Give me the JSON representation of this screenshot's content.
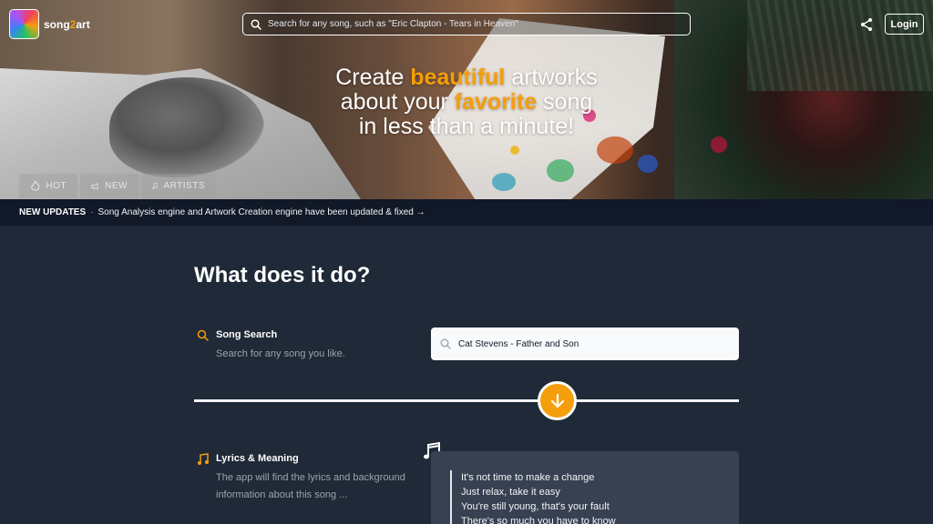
{
  "app": {
    "name_part1": "song",
    "name_part2": "2",
    "name_part3": "art"
  },
  "search": {
    "placeholder": "Search for any song, such as \"Eric Clapton - Tears in Heaven\""
  },
  "header": {
    "login_label": "Login"
  },
  "hero": {
    "line1_pre": "Create ",
    "line1_hl": "beautiful",
    "line1_post": " artworks",
    "line2_pre": "about your ",
    "line2_hl": "favorite",
    "line2_post": " song",
    "line3": "in less than a minute!",
    "tabs": [
      {
        "label": "HOT",
        "icon": "flame-icon"
      },
      {
        "label": "NEW",
        "icon": "megaphone-icon"
      },
      {
        "label": "ARTISTS",
        "icon": "music-note-icon"
      }
    ]
  },
  "updates": {
    "label": "NEW UPDATES",
    "separator": "·",
    "message": "Song Analysis engine and Artwork Creation engine have been updated & fixed →"
  },
  "main": {
    "title": "What does it do?",
    "features": [
      {
        "title": "Song Search",
        "description": "Search for any song you like.",
        "icon": "search-icon"
      },
      {
        "title": "Lyrics & Meaning",
        "description": "The app will find the lyrics and background information about this song ...",
        "icon": "music-note-icon"
      }
    ],
    "demo_search_value": "Cat Stevens - Father and Son",
    "lyrics": [
      "It's not time to make a change",
      "Just relax, take it easy",
      "You're still young, that's your fault",
      "There's so much you have to know"
    ]
  },
  "colors": {
    "accent": "#f59e0b",
    "background": "#1f2937",
    "updates_bar": "#111827",
    "card": "#374151"
  }
}
